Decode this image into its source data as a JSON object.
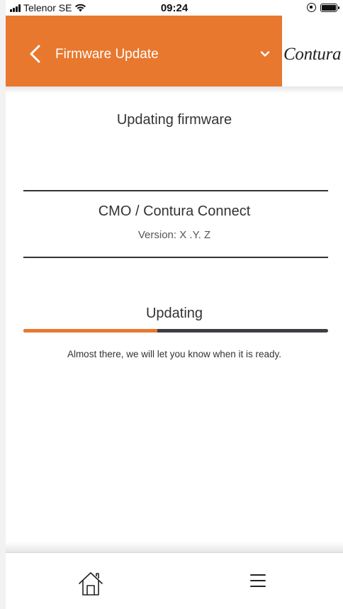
{
  "status_bar": {
    "carrier": "Telenor SE",
    "time": "09:24",
    "icons": [
      "signal-icon",
      "wifi-icon",
      "rotation-lock-icon",
      "battery-icon"
    ]
  },
  "header": {
    "title": "Firmware Update",
    "back_icon": "chevron-left-icon",
    "dropdown_icon": "chevron-down-icon",
    "logo": "Contura",
    "background_color": "#e8782e"
  },
  "main": {
    "title": "Updating firmware",
    "device": {
      "name": "CMO / Contura Connect",
      "version": "Version: X .Y. Z"
    },
    "progress": {
      "label": "Updating",
      "percent": 44,
      "fill_color": "#e8782e",
      "track_color": "#3d3f45",
      "message": "Almost there, we will let you know when it is ready."
    }
  },
  "bottom_nav": {
    "items": [
      {
        "icon": "home-icon"
      },
      {
        "icon": "hamburger-menu-icon"
      }
    ]
  }
}
